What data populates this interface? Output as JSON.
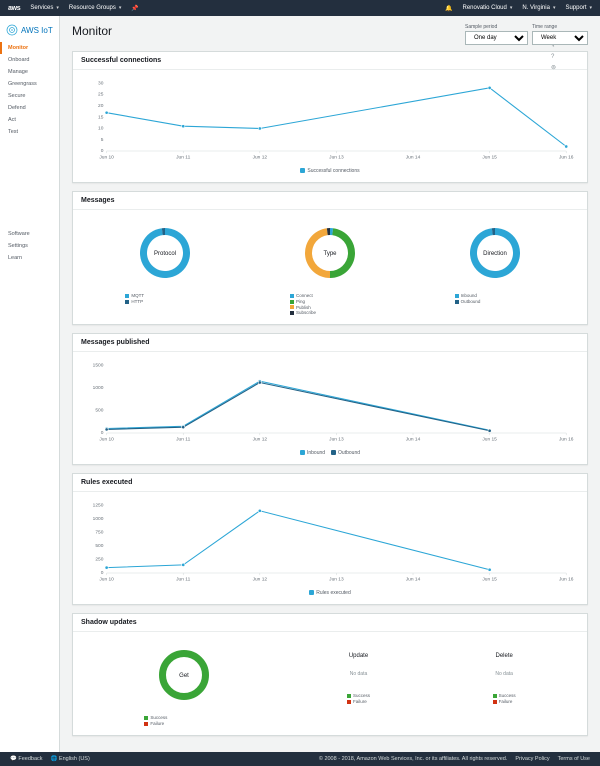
{
  "topbar": {
    "services": "Services",
    "resource_groups": "Resource Groups",
    "account": "Renovatio Cloud",
    "region": "N. Virginia",
    "support": "Support"
  },
  "brand": "AWS IoT",
  "nav": [
    "Monitor",
    "Onboard",
    "Manage",
    "Greengrass",
    "Secure",
    "Defend",
    "Act",
    "Test"
  ],
  "nav_bottom": [
    "Software",
    "Settings",
    "Learn"
  ],
  "page_title": "Monitor",
  "controls": {
    "sample_label": "Sample period",
    "sample_value": "One day",
    "range_label": "Time range",
    "range_value": "Week"
  },
  "panels": {
    "conn": "Successful connections",
    "messages": "Messages",
    "published": "Messages published",
    "rules": "Rules executed",
    "shadow": "Shadow updates"
  },
  "donut_center": {
    "protocol": "Protocol",
    "type": "Type",
    "direction": "Direction",
    "get": "Get",
    "update": "Update",
    "delete": "Delete",
    "nodata": "No data"
  },
  "legends": {
    "conn": "Successful connections",
    "protocol": [
      "MQTT",
      "HTTP"
    ],
    "type": [
      "Connect",
      "Ping",
      "Publish",
      "Subscribe"
    ],
    "direction": [
      "Inbound",
      "Outbound"
    ],
    "published": [
      "Inbound",
      "Outbound"
    ],
    "rules": "Rules executed",
    "shadow": [
      "Success",
      "Failure"
    ]
  },
  "footer": {
    "feedback": "Feedback",
    "lang": "English (US)",
    "copyright": "© 2008 - 2018, Amazon Web Services, Inc. or its affiliates. All rights reserved.",
    "privacy": "Privacy Policy",
    "terms": "Terms of Use"
  },
  "chart_data": [
    {
      "id": "conn",
      "type": "line",
      "x": [
        "Jun 10",
        "Jun 11",
        "Jun 12",
        "Jun 13",
        "Jun 14",
        "Jun 15",
        "Jun 16"
      ],
      "series": [
        {
          "name": "Successful connections",
          "values": [
            17,
            11,
            10,
            null,
            null,
            28,
            2
          ]
        }
      ],
      "ylim": [
        0,
        30
      ],
      "yticks": [
        0,
        5,
        10,
        15,
        20,
        25,
        30
      ]
    },
    {
      "id": "protocol",
      "type": "pie",
      "slices": [
        {
          "name": "MQTT",
          "value": 98,
          "color": "#2ca6d6"
        },
        {
          "name": "HTTP",
          "value": 2,
          "color": "#226287"
        }
      ]
    },
    {
      "id": "type",
      "type": "pie",
      "slices": [
        {
          "name": "Connect",
          "value": 2,
          "color": "#2ca6d6"
        },
        {
          "name": "Ping",
          "value": 48,
          "color": "#3aa537"
        },
        {
          "name": "Publish",
          "value": 48,
          "color": "#f2a73b"
        },
        {
          "name": "Subscribe",
          "value": 2,
          "color": "#232f3e"
        }
      ]
    },
    {
      "id": "direction",
      "type": "pie",
      "slices": [
        {
          "name": "Inbound",
          "value": 98,
          "color": "#2ca6d6"
        },
        {
          "name": "Outbound",
          "value": 2,
          "color": "#226287"
        }
      ]
    },
    {
      "id": "published",
      "type": "line",
      "x": [
        "Jun 10",
        "Jun 11",
        "Jun 12",
        "Jun 13",
        "Jun 14",
        "Jun 15",
        "Jun 16"
      ],
      "series": [
        {
          "name": "Inbound",
          "values": [
            100,
            150,
            1150,
            null,
            null,
            60,
            null
          ]
        },
        {
          "name": "Outbound",
          "values": [
            80,
            130,
            1120,
            null,
            null,
            50,
            null
          ]
        }
      ],
      "ylim": [
        0,
        1500
      ],
      "yticks": [
        0,
        500,
        1000,
        1500
      ]
    },
    {
      "id": "rules",
      "type": "line",
      "x": [
        "Jun 10",
        "Jun 11",
        "Jun 12",
        "Jun 13",
        "Jun 14",
        "Jun 15",
        "Jun 16"
      ],
      "series": [
        {
          "name": "Rules executed",
          "values": [
            100,
            150,
            1150,
            null,
            null,
            60,
            null
          ]
        }
      ],
      "ylim": [
        0,
        1250
      ],
      "yticks": [
        0,
        250,
        500,
        750,
        1000,
        1250
      ]
    },
    {
      "id": "get",
      "type": "pie",
      "slices": [
        {
          "name": "Success",
          "value": 100,
          "color": "#3aa537"
        },
        {
          "name": "Failure",
          "value": 0,
          "color": "#d13212"
        }
      ]
    }
  ]
}
